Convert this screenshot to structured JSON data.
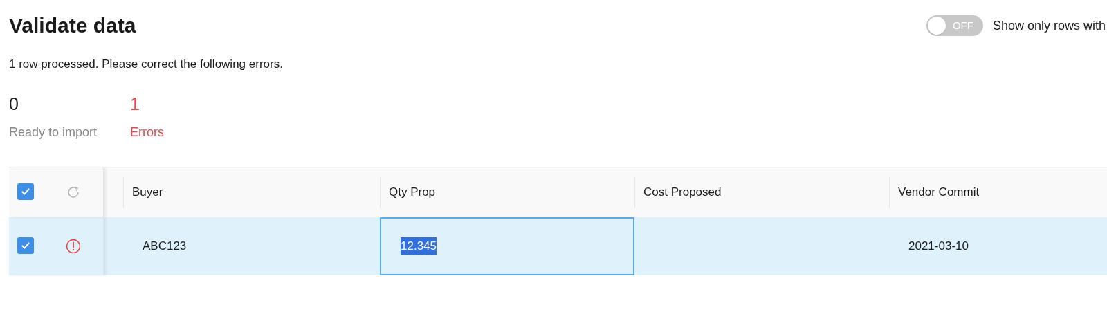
{
  "title": "Validate data",
  "toggle": {
    "on": false,
    "state_label": "OFF",
    "label": "Show only rows with"
  },
  "summary": "1 row processed. Please correct the following errors.",
  "stats": [
    {
      "kind": "ready",
      "value": "0",
      "label": "Ready to import"
    },
    {
      "kind": "error",
      "value": "1",
      "label": "Errors"
    }
  ],
  "table": {
    "header_checked": true,
    "columns": [
      "Buyer",
      "Qty Prop",
      "Cost Proposed",
      "Vendor Commit"
    ],
    "rows": [
      {
        "checked": true,
        "error": true,
        "cells": [
          {
            "text": "ABC123",
            "focused": false
          },
          {
            "text": "12.345",
            "focused": true
          },
          {
            "focused": false
          },
          {
            "text": "2021-03-10",
            "focused": false
          }
        ]
      }
    ]
  }
}
